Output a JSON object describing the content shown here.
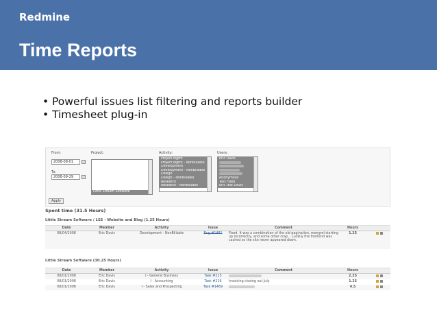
{
  "header": {
    "brand": "Redmine",
    "title": "Time Reports"
  },
  "bullets": [
    "Powerful issues list filtering and reports builder",
    "Timesheet plug-in"
  ],
  "screenshot": {
    "from_label": "From:",
    "from_value": "2008-08-01",
    "to_label": "To:",
    "to_value": "2008-09-29",
    "project_label": "Project:",
    "project_options": [
      "Little Stream Software"
    ],
    "activity_label": "Activity:",
    "activity_options": [
      "Project Mgmt",
      "Project Mgmt - NonBillable",
      "Development",
      "Development - NonBillable",
      "Design",
      "Design - NonBillable",
      "Research",
      "Research - NonBillable"
    ],
    "users_label": "Users:",
    "users_options": [
      "Eric Davis",
      "",
      "",
      "",
      "",
      "Anonymous",
      "Test Fixed",
      "Eric Test Davis"
    ],
    "apply_label": "Apply",
    "spent_time_heading": "Spent time (31.5 Hours)",
    "group1": {
      "heading": "Little Stream Software / LSS - Website and Blog (1.25 Hours)",
      "columns": [
        "Date",
        "Member",
        "Activity",
        "Issue",
        "Comment",
        "Hours"
      ],
      "rows": [
        {
          "date": "08/04/2008",
          "member": "Eric Davis",
          "activity": "Development - NonBillable",
          "issue": "Bug #1481",
          "comment": "Fixed. It was a combination of the old pagination, mongrel starting up incorrectly, and some other crap... Luckily the frontend was cached so the site never appeared down.",
          "hours": "1.25"
        }
      ]
    },
    "group2": {
      "heading": "Little Stream Software (30.25 Hours)",
      "columns": [
        "Date",
        "Member",
        "Activity",
        "Issue",
        "Comment",
        "Hours"
      ],
      "rows": [
        {
          "date": "08/01/2008",
          "member": "Eric Davis",
          "activity": "I - General Business",
          "issue": "Task #215",
          "comment": "",
          "hours": "2.25"
        },
        {
          "date": "08/01/2008",
          "member": "Eric Davis",
          "activity": "I - Accounting",
          "issue": "Task #216",
          "comment": "Invoicing closing out July",
          "hours": "1.25"
        },
        {
          "date": "08/01/2008",
          "member": "Eric Davis",
          "activity": "I - Sales and Prospecting",
          "issue": "Task #1469",
          "comment": "",
          "hours": "4.5"
        }
      ]
    }
  }
}
